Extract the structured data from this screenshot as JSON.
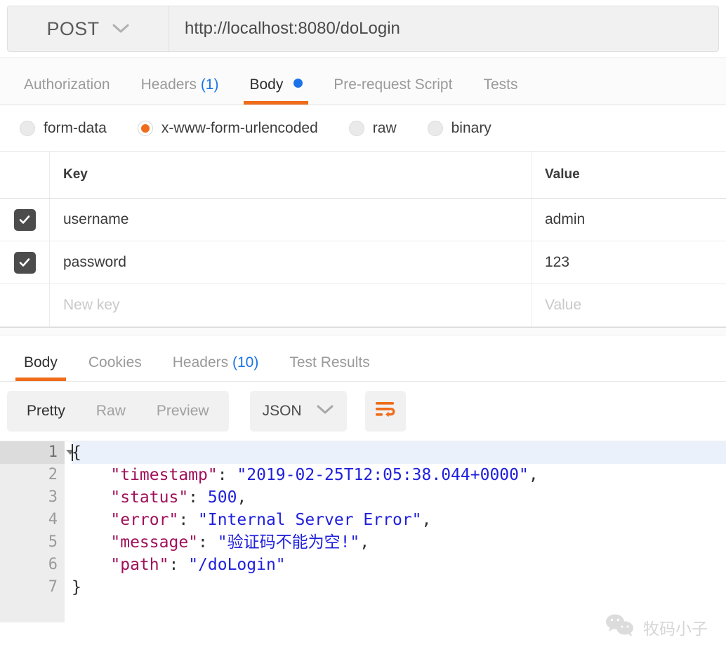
{
  "request": {
    "method": "POST",
    "method_caret_icon": "chevron-down-icon",
    "url": "http://localhost:8080/doLogin",
    "tabs": [
      {
        "label": "Authorization",
        "active": false,
        "count": "",
        "dot": false
      },
      {
        "label": "Headers",
        "active": false,
        "count": "(1)",
        "dot": false
      },
      {
        "label": "Body",
        "active": true,
        "count": "",
        "dot": true
      },
      {
        "label": "Pre-request Script",
        "active": false,
        "count": "",
        "dot": false
      },
      {
        "label": "Tests",
        "active": false,
        "count": "",
        "dot": false
      }
    ],
    "body_types": [
      {
        "label": "form-data",
        "selected": false
      },
      {
        "label": "x-www-form-urlencoded",
        "selected": true
      },
      {
        "label": "raw",
        "selected": false
      },
      {
        "label": "binary",
        "selected": false
      }
    ],
    "table": {
      "headers": {
        "key": "Key",
        "value": "Value"
      },
      "rows": [
        {
          "checked": true,
          "key": "username",
          "value": "admin",
          "placeholder": false
        },
        {
          "checked": true,
          "key": "password",
          "value": "123",
          "placeholder": false
        }
      ],
      "new_row": {
        "key_placeholder": "New key",
        "value_placeholder": "Value"
      }
    }
  },
  "response": {
    "tabs": [
      {
        "label": "Body",
        "active": true,
        "count": ""
      },
      {
        "label": "Cookies",
        "active": false,
        "count": ""
      },
      {
        "label": "Headers",
        "active": false,
        "count": "(10)"
      },
      {
        "label": "Test Results",
        "active": false,
        "count": ""
      }
    ],
    "view_modes": [
      {
        "label": "Pretty",
        "active": true
      },
      {
        "label": "Raw",
        "active": false
      },
      {
        "label": "Preview",
        "active": false
      }
    ],
    "format": {
      "label": "JSON",
      "caret_icon": "chevron-down-icon"
    },
    "wrap_button_icon": "word-wrap-icon",
    "body_json": {
      "timestamp": "2019-02-25T12:05:38.044+0000",
      "status": 500,
      "error": "Internal Server Error",
      "message": "验证码不能为空!",
      "path": "/doLogin"
    },
    "code_lines": [
      {
        "num": "1",
        "highlighted": true,
        "folder": true
      },
      {
        "num": "2",
        "highlighted": false,
        "folder": false
      },
      {
        "num": "3",
        "highlighted": false,
        "folder": false
      },
      {
        "num": "4",
        "highlighted": false,
        "folder": false
      },
      {
        "num": "5",
        "highlighted": false,
        "folder": false
      },
      {
        "num": "6",
        "highlighted": false,
        "folder": false
      },
      {
        "num": "7",
        "highlighted": false,
        "folder": false
      }
    ]
  },
  "watermark": {
    "icon": "wechat-icon",
    "text": "牧码小子"
  },
  "colors": {
    "accent_orange": "#ef6c1a",
    "link_blue": "#1a73e8",
    "json_key": "#a0105a",
    "json_value": "#1f1fdd",
    "checkbox": "#4c4c4c"
  }
}
